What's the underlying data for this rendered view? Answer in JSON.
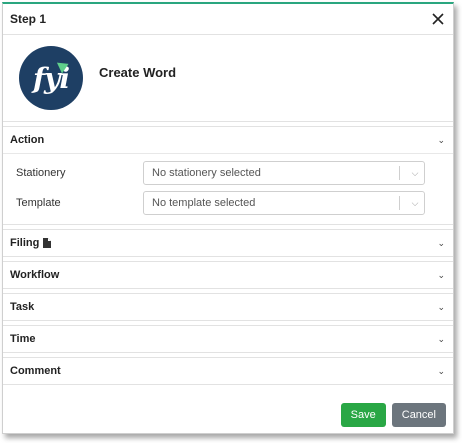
{
  "dialog": {
    "title": "Step 1",
    "doc_name": "Create Word",
    "logo_text": "fyi"
  },
  "sections": {
    "action": {
      "label": "Action",
      "stationery": {
        "label": "Stationery",
        "value": "No stationery selected"
      },
      "template": {
        "label": "Template",
        "value": "No template selected"
      }
    },
    "filing": {
      "label": "Filing"
    },
    "workflow": {
      "label": "Workflow"
    },
    "task": {
      "label": "Task"
    },
    "time": {
      "label": "Time"
    },
    "comment": {
      "label": "Comment"
    }
  },
  "footer": {
    "save_label": "Save",
    "cancel_label": "Cancel"
  },
  "colors": {
    "accent": "#2aa67f",
    "logo_bg": "#1e3f64",
    "save": "#29a745",
    "cancel": "#6c757d"
  }
}
